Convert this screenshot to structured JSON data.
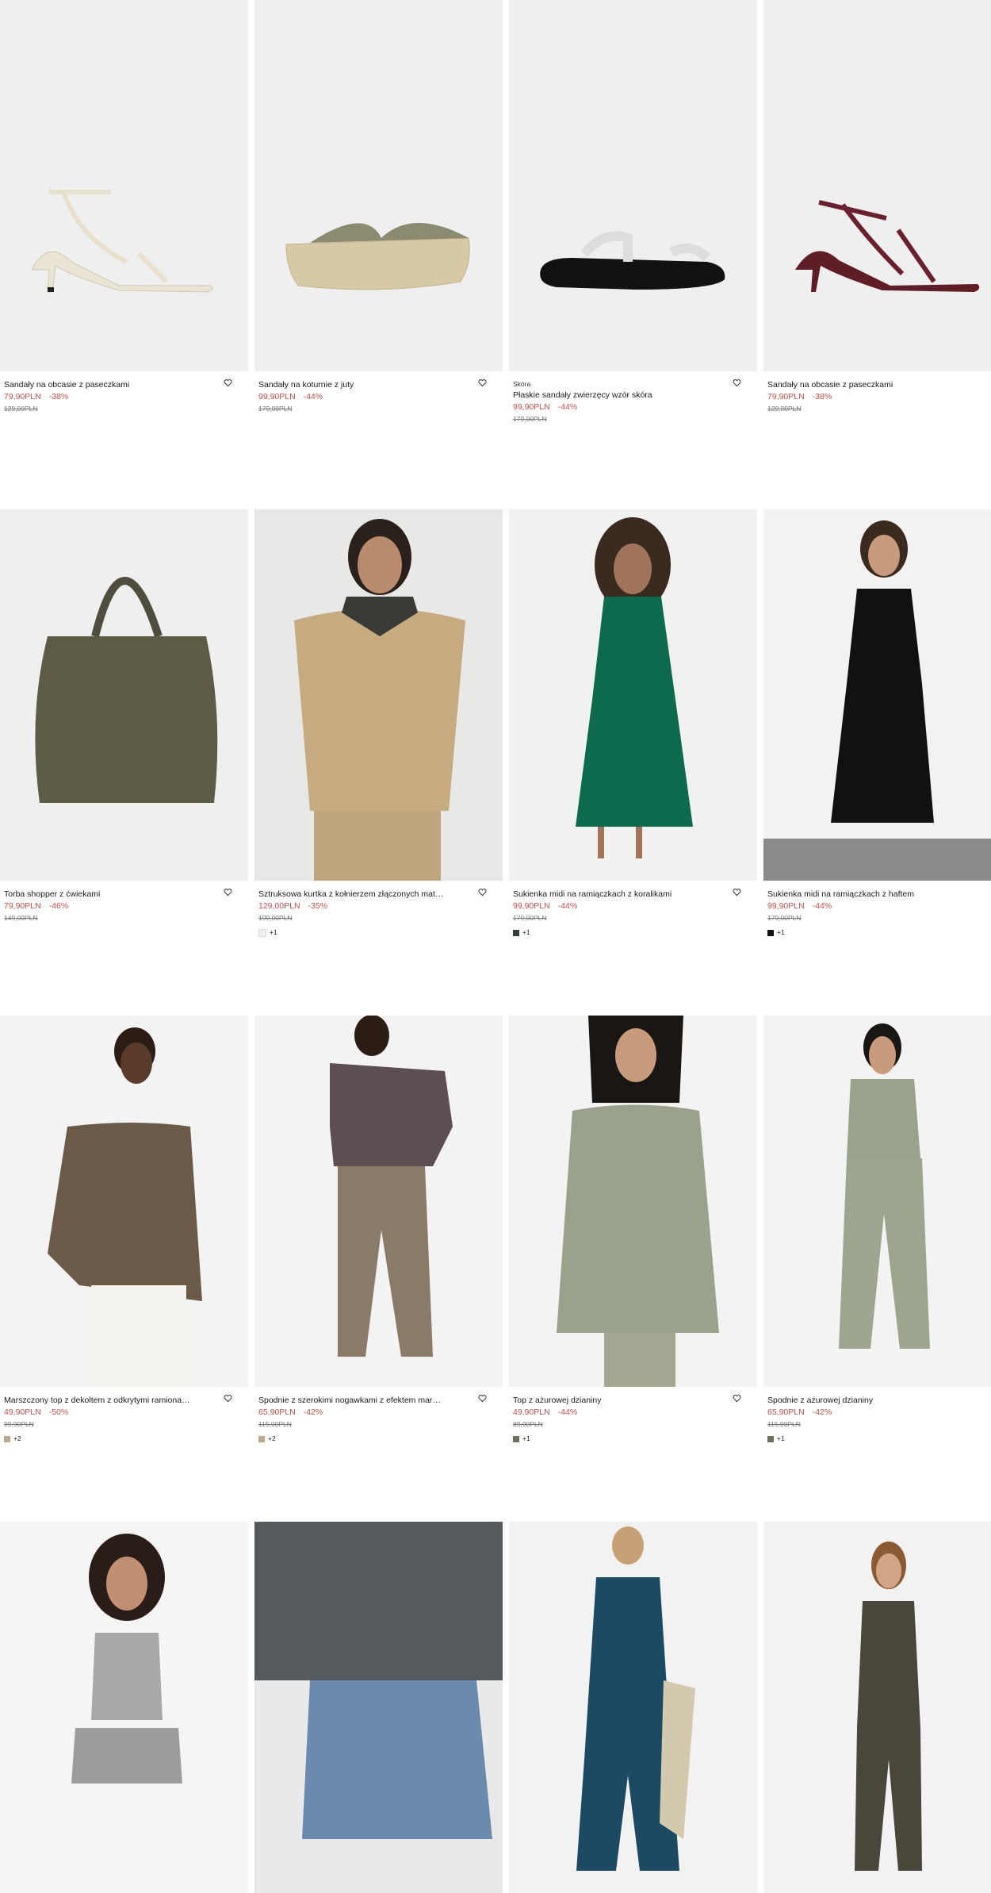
{
  "products": [
    {
      "name": "Sandały na obcasie z paseczkami",
      "price": "79,90PLN",
      "discount": "-38%",
      "old_price": "129,00PLN"
    },
    {
      "name": "Sandały na koturnie z juty",
      "price": "99,90PLN",
      "discount": "-44%",
      "old_price": "179,00PLN"
    },
    {
      "tag": "Skóra",
      "name": "Płaskie sandały zwierzęcy wzór skóra",
      "price": "99,90PLN",
      "discount": "-44%",
      "old_price": "179,00PLN"
    },
    {
      "name": "Sandały na obcasie z paseczkami",
      "price": "79,90PLN",
      "discount": "-38%",
      "old_price": "129,00PLN"
    },
    {
      "name": "Torba shopper z ćwiekami",
      "price": "79,90PLN",
      "discount": "-46%",
      "old_price": "149,00PLN"
    },
    {
      "name": "Sztruksowa kurtka z kołnierzem złączonych materiał...",
      "price": "129,00PLN",
      "discount": "-35%",
      "old_price": "199,00PLN",
      "swatch_color": "#efefef",
      "more_colors": "+1"
    },
    {
      "name": "Sukienka midi na ramiączkach z koralikami",
      "price": "99,90PLN",
      "discount": "-44%",
      "old_price": "179,00PLN",
      "swatch_color": "#2f3f3a",
      "more_colors": "+1"
    },
    {
      "name": "Sukienka midi na ramiączkach z haftem",
      "price": "99,90PLN",
      "discount": "-44%",
      "old_price": "179,00PLN",
      "swatch_color": "#111111",
      "more_colors": "+1"
    },
    {
      "name": "Marszczony top z dekoltem z odkrytymi ramionami",
      "price": "49,90PLN",
      "discount": "-50%",
      "old_price": "99,90PLN",
      "swatch_color": "#b9a98d",
      "more_colors": "+2"
    },
    {
      "name": "Spodnie z szerokimi nogawkami z efektem marszcze...",
      "price": "65,90PLN",
      "discount": "-42%",
      "old_price": "115,00PLN",
      "swatch_color": "#b9a98d",
      "more_colors": "+2"
    },
    {
      "name": "Top z ażurowej dzianiny",
      "price": "49,90PLN",
      "discount": "-44%",
      "old_price": "89,90PLN",
      "swatch_color": "#6f6f5a",
      "more_colors": "+1"
    },
    {
      "name": "Spodnie z ażurowej dzianiny",
      "price": "65,90PLN",
      "discount": "-42%",
      "old_price": "115,00PLN",
      "swatch_color": "#6f6f5a",
      "more_colors": "+1"
    }
  ],
  "colors": {
    "price_red": "#c0504d",
    "image_bg": "#efefef"
  }
}
